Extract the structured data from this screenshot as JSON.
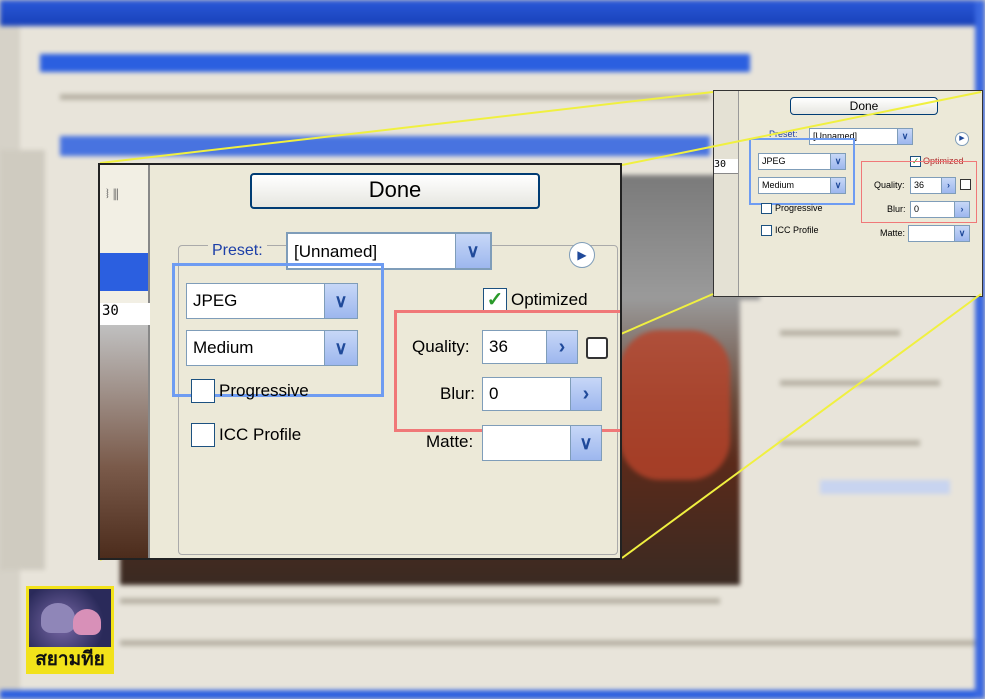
{
  "main_dialog": {
    "done_label": "Done",
    "preset_label": "Preset:",
    "preset_value": "[Unnamed]",
    "format_value": "JPEG",
    "compression_value": "Medium",
    "optimized_label": "Optimized",
    "optimized_checked": true,
    "quality_label": "Quality:",
    "quality_value": "36",
    "blur_label": "Blur:",
    "blur_value": "0",
    "progressive_label": "Progressive",
    "icc_label": "ICC Profile",
    "matte_label": "Matte:",
    "matte_value": "",
    "ruler_value": "30"
  },
  "zoom_panel": {
    "done_label": "Done",
    "preset_label": "Preset:",
    "preset_value": "[Unnamed]",
    "format_value": "JPEG",
    "compression_value": "Medium",
    "optimized_label": "Optimized",
    "quality_label": "Quality:",
    "quality_value": "36",
    "blur_label": "Blur:",
    "blur_value": "0",
    "progressive_label": "Progressive",
    "icc_label": "ICC Profile",
    "matte_label": "Matte:",
    "ruler_value": "30"
  },
  "logo": {
    "text": "สยามทีย"
  },
  "colors": {
    "highlight_blue": "#6e9cf2",
    "highlight_red": "#f07878",
    "connector": "#f0f040"
  }
}
